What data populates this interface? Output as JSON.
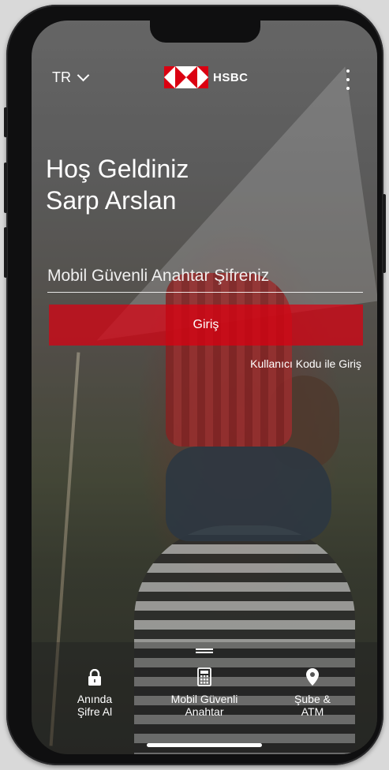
{
  "header": {
    "language": "TR",
    "brand": "HSBC"
  },
  "welcome": {
    "line1": "Hoş Geldiniz",
    "line2": "Sarp Arslan"
  },
  "login": {
    "password_placeholder": "Mobil Güvenli Anahtar Şifreniz",
    "password_value": "",
    "button_label": "Giriş",
    "usercode_link": "Kullanıcı Kodu ile Giriş"
  },
  "bottom_nav": {
    "items": [
      {
        "line1": "Anında",
        "line2": "Şifre Al",
        "icon": "lock-icon"
      },
      {
        "line1": "Mobil Güvenli",
        "line2": "Anahtar",
        "icon": "calculator-icon"
      },
      {
        "line1": "Şube &",
        "line2": "ATM",
        "icon": "location-pin-icon"
      }
    ]
  },
  "colors": {
    "brand_red": "#db0011",
    "text": "#ffffff"
  }
}
